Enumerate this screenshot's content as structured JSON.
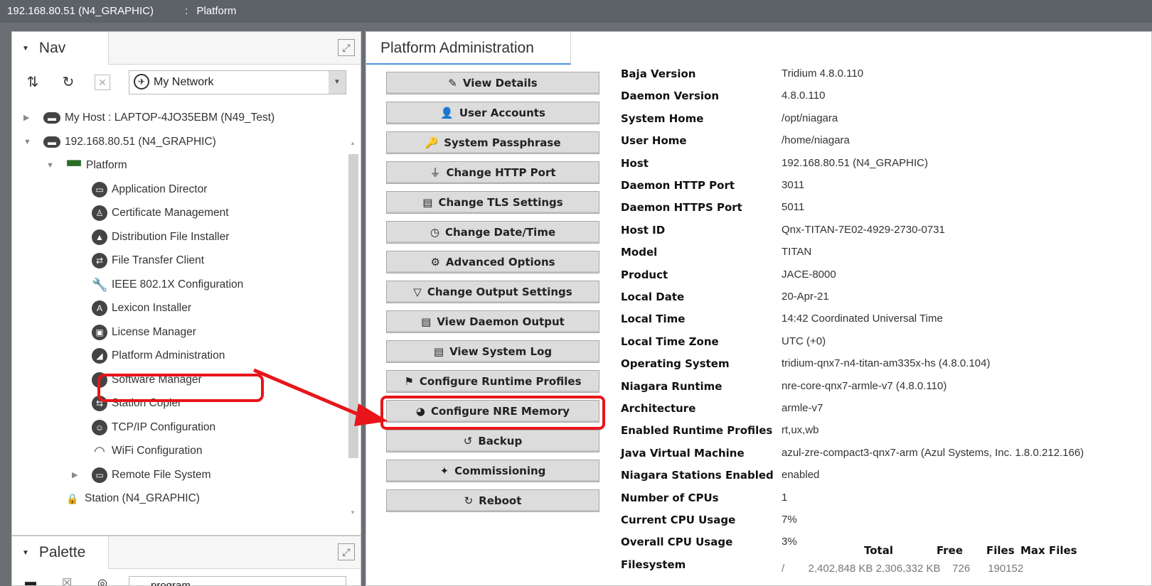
{
  "window": {
    "title": "192.168.80.51 (N4_GRAPHIC)",
    "separator": ":",
    "view": "Platform"
  },
  "nav": {
    "tab_label": "Nav",
    "network_select": "My Network",
    "tree": [
      {
        "label": "My Host : LAPTOP-4JO35EBM (N49_Test)",
        "icon": "host-icon"
      },
      {
        "label": "192.168.80.51 (N4_GRAPHIC)",
        "icon": "host-icon"
      },
      {
        "label": "Platform",
        "icon": "platform-icon"
      },
      {
        "label": "Application Director",
        "icon": "app-director-icon"
      },
      {
        "label": "Certificate Management",
        "icon": "certificate-icon"
      },
      {
        "label": "Distribution File Installer",
        "icon": "installer-icon"
      },
      {
        "label": "File Transfer Client",
        "icon": "file-transfer-icon"
      },
      {
        "label": "IEEE 802.1X Configuration",
        "icon": "wrench-icon"
      },
      {
        "label": "Lexicon Installer",
        "icon": "lexicon-icon"
      },
      {
        "label": "License Manager",
        "icon": "license-icon"
      },
      {
        "label": "Platform Administration",
        "icon": "platform-admin-icon"
      },
      {
        "label": "Software Manager",
        "icon": "software-icon"
      },
      {
        "label": "Station Copier",
        "icon": "copier-icon"
      },
      {
        "label": "TCP/IP Configuration",
        "icon": "tcpip-icon"
      },
      {
        "label": "WiFi Configuration",
        "icon": "wifi-icon"
      },
      {
        "label": "Remote File System",
        "icon": "remote-fs-icon"
      },
      {
        "label": "Station (N4_GRAPHIC)",
        "icon": "station-icon"
      }
    ]
  },
  "palette": {
    "tab_label": "Palette",
    "select": "program"
  },
  "main": {
    "tab_label": "Platform Administration",
    "buttons": [
      "View Details",
      "User Accounts",
      "System Passphrase",
      "Change HTTP Port",
      "Change TLS Settings",
      "Change Date/Time",
      "Advanced Options",
      "Change Output Settings",
      "View Daemon Output",
      "View System Log",
      "Configure Runtime Profiles",
      "Configure NRE Memory",
      "Backup",
      "Commissioning",
      "Reboot"
    ],
    "properties": [
      {
        "k": "Baja Version",
        "v": "Tridium 4.8.0.110"
      },
      {
        "k": "Daemon Version",
        "v": "4.8.0.110"
      },
      {
        "k": "System Home",
        "v": "/opt/niagara"
      },
      {
        "k": "User Home",
        "v": "/home/niagara"
      },
      {
        "k": "Host",
        "v": "192.168.80.51 (N4_GRAPHIC)"
      },
      {
        "k": "Daemon HTTP Port",
        "v": "3011"
      },
      {
        "k": "Daemon HTTPS Port",
        "v": "5011"
      },
      {
        "k": "Host ID",
        "v": "Qnx-TITAN-7E02-4929-2730-0731"
      },
      {
        "k": "Model",
        "v": "TITAN"
      },
      {
        "k": "Product",
        "v": "JACE-8000"
      },
      {
        "k": "Local Date",
        "v": "20-Apr-21"
      },
      {
        "k": "Local Time",
        "v": "14:42 Coordinated Universal Time"
      },
      {
        "k": "Local Time Zone",
        "v": "UTC (+0)"
      },
      {
        "k": "Operating System",
        "v": "tridium-qnx7-n4-titan-am335x-hs (4.8.0.104)"
      },
      {
        "k": "Niagara Runtime",
        "v": "nre-core-qnx7-armle-v7 (4.8.0.110)"
      },
      {
        "k": "Architecture",
        "v": "armle-v7"
      },
      {
        "k": "Enabled Runtime Profiles",
        "v": "rt,ux,wb"
      },
      {
        "k": "Java Virtual Machine",
        "v": "azul-zre-compact3-qnx7-arm (Azul Systems, Inc. 1.8.0.212.166)"
      },
      {
        "k": "Niagara Stations Enabled",
        "v": "enabled"
      },
      {
        "k": "Number of CPUs",
        "v": "1"
      },
      {
        "k": "Current CPU Usage",
        "v": "7%"
      },
      {
        "k": "Overall CPU Usage",
        "v": "3%"
      },
      {
        "k": "Filesystem",
        "v": ""
      }
    ],
    "fs_headers": [
      "Total",
      "Free",
      "Files",
      "Max Files"
    ],
    "fs_row_partial": "/        2,402,848 KB 2,306,332 KB    726      190152"
  }
}
